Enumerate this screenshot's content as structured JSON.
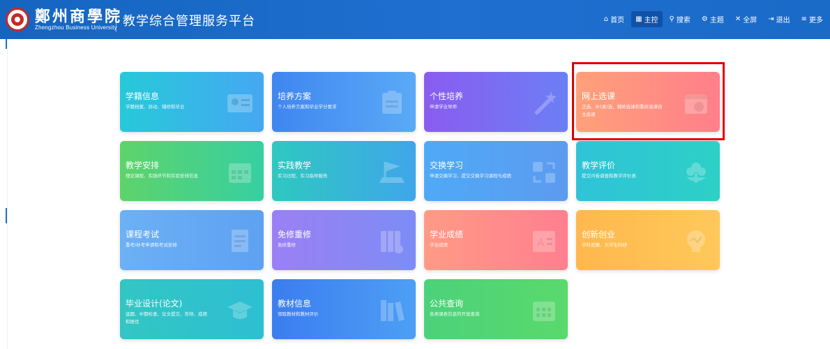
{
  "header": {
    "school_name_cn": "鄭州商學院",
    "school_name_en": "Zhengzhou Business University",
    "platform_title": "教学综合管理服务平台",
    "brand_color": "#1e6fd0"
  },
  "nav": [
    {
      "icon": "home-icon",
      "glyph": "⌂",
      "label": "首页",
      "active": false
    },
    {
      "icon": "dashboard-icon",
      "glyph": "▦",
      "label": "主控",
      "active": true
    },
    {
      "icon": "search-icon",
      "glyph": "⚲",
      "label": "搜索",
      "active": false
    },
    {
      "icon": "theme-icon",
      "glyph": "⚙",
      "label": "主题",
      "active": false
    },
    {
      "icon": "fullscreen-icon",
      "glyph": "✕",
      "label": "全屏",
      "active": false
    },
    {
      "icon": "logout-icon",
      "glyph": "⇥",
      "label": "退出",
      "active": false
    },
    {
      "icon": "more-icon",
      "glyph": "≡",
      "label": "更多",
      "active": false
    }
  ],
  "tiles": [
    {
      "title": "学籍信息",
      "desc": "学籍档案、异动、辅修和毕业",
      "icon": "id-card-icon",
      "gradient": "g-teal"
    },
    {
      "title": "培养方案",
      "desc": "个人培养方案和毕业学分要求",
      "icon": "clipboard-icon",
      "gradient": "g-blue"
    },
    {
      "title": "个性培养",
      "desc": "申请学业导师",
      "icon": "magic-wand-icon",
      "gradient": "g-purple"
    },
    {
      "title": "网上选课",
      "desc": "正选、补(退)选、辅修选课和重修选课自主选课",
      "icon": "calendar-check-icon",
      "gradient": "g-peach"
    },
    {
      "title": "教学安排",
      "desc": "理论课程、实践环节和实验安排信息",
      "icon": "calendar-icon",
      "gradient": "g-green"
    },
    {
      "title": "实践教学",
      "desc": "实习过程、实习指导服务",
      "icon": "flag-icon",
      "gradient": "g-teal2"
    },
    {
      "title": "交换学习",
      "desc": "申请交换学习、提交交换学习课程与成绩",
      "icon": "exchange-icon",
      "gradient": "g-lblue"
    },
    {
      "title": "教学评价",
      "desc": "提交问卷调查和教学评价表",
      "icon": "flower-icon",
      "gradient": "g-cyan"
    },
    {
      "title": "课程考试",
      "desc": "重考/补考申请和考试安排",
      "icon": "document-icon",
      "gradient": "g-sky"
    },
    {
      "title": "免修重修",
      "desc": "免修重修",
      "icon": "books-icon",
      "gradient": "g-violet"
    },
    {
      "title": "学业成绩",
      "desc": "学业成绩",
      "icon": "grade-icon",
      "gradient": "g-salmon"
    },
    {
      "title": "创新创业",
      "desc": "学科竞赛、大学生科研",
      "icon": "lightbulb-icon",
      "gradient": "g-orange"
    },
    {
      "title": "毕业设计(论文)",
      "desc": "选题、中期检查、论文提交、答辩、成绩和推优",
      "icon": "graduation-cap-icon",
      "gradient": "g-tealgreen"
    },
    {
      "title": "教材信息",
      "desc": "领取教材和教材评价",
      "icon": "bookshelf-icon",
      "gradient": "g-deepblue"
    },
    {
      "title": "公共查询",
      "desc": "各类课表信息的开放查询",
      "icon": "calendar-grid-icon",
      "gradient": "g-lime"
    }
  ],
  "highlight_color": "#e00000"
}
